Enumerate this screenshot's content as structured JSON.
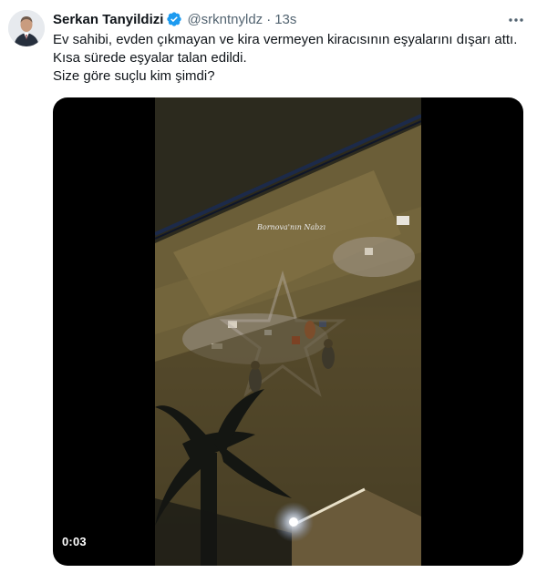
{
  "tweet": {
    "author_name": "Serkan Tanyildizi",
    "handle": "@srkntnyldz",
    "separator": "·",
    "time": "13s",
    "verified": true,
    "text_lines": [
      "Ev sahibi, evden çıkmayan ve kira vermeyen kiracısının eşyalarını dışarı attı.",
      "Kısa sürede eşyalar talan edildi.",
      "Size göre suçlu kim şimdi?"
    ]
  },
  "video": {
    "duration": "0:03",
    "watermark": "Bornova'nın Nabzı"
  },
  "colors": {
    "verified_badge": "#1d9bf0",
    "secondary_text": "#536471",
    "primary_text": "#0f1419"
  },
  "icons": {
    "verified": "verified-badge-icon",
    "more": "more-options-icon"
  }
}
